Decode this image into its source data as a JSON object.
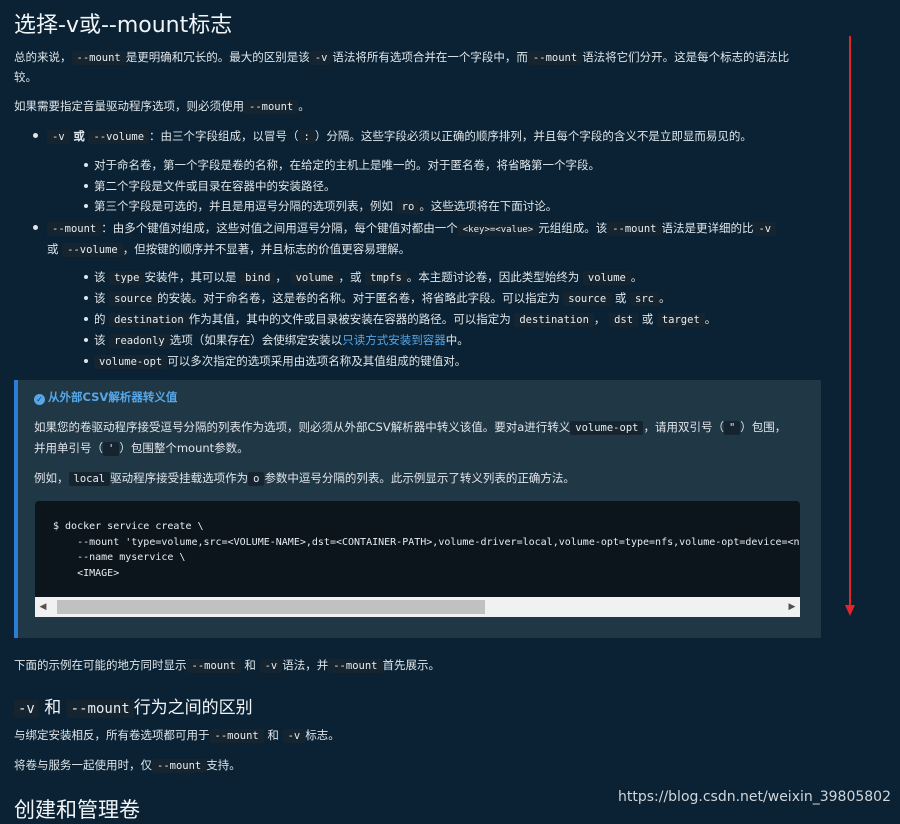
{
  "title": "选择-v或--mount标志",
  "intro": {
    "p1_a": "总的来说，",
    "p1_code1": "--mount",
    "p1_b": "是更明确和冗长的。最大的区别是该",
    "p1_code2": "-v",
    "p1_c": "语法将所有选项合并在一个字段中，而",
    "p1_code3": "--mount",
    "p1_d": "语法将它们分开。这是每个标志的语法比",
    "p1_e": "较。",
    "p2_a": "如果需要指定音量驱动程序选项，则必须使用",
    "p2_code": "--mount",
    "p2_b": "。"
  },
  "bullet_v": {
    "code1": "-v",
    "or": "或",
    "code2": "--volume",
    "text": "：由三个字段组成，以冒号（",
    "colon": ":",
    "text2": "）分隔。这些字段必须以正确的顺序排列，并且每个字段的含义不是立即显而易见的。",
    "sub1": "对于命名卷，第一个字段是卷的名称，在给定的主机上是唯一的。对于匿名卷，将省略第一个字段。",
    "sub2": "第二个字段是文件或目录在容器中的安装路径。",
    "sub3_a": "第三个字段是可选的，并且是用逗号分隔的选项列表，例如",
    "sub3_code": "ro",
    "sub3_b": "。这些选项将在下面讨论。"
  },
  "bullet_mount": {
    "code": "--mount",
    "text_a": "：由多个键值对组成，这些对值之间用逗号分隔，每个键值对都由一个",
    "kv": "<key>=<value>",
    "text_b": "元组组成。该",
    "code2": "--mount",
    "text_c": "语法是更详细的比",
    "code3": "-v",
    "line2_a": "或",
    "code4": "--volume",
    "line2_b": "，但按键的顺序并不显著，并且标志的价值更容易理解。",
    "s1_a": "该",
    "s1_c1": "type",
    "s1_b": "安装件，其可以是",
    "s1_c2": "bind",
    "s1_sep1": "，",
    "s1_c3": "volume",
    "s1_sep2": "，或",
    "s1_c4": "tmpfs",
    "s1_c": "。本主题讨论卷，因此类型始终为",
    "s1_c5": "volume",
    "s1_end": "。",
    "s2_a": "该",
    "s2_c1": "source",
    "s2_b": "的安装。对于命名卷，这是卷的名称。对于匿名卷，将省略此字段。可以指定为",
    "s2_c2": "source",
    "s2_or": "或",
    "s2_c3": "src",
    "s2_end": "。",
    "s3_a": "的",
    "s3_c1": "destination",
    "s3_b": "作为其值，其中的文件或目录被安装在容器的路径。可以指定为",
    "s3_c2": "destination",
    "s3_sep": "，",
    "s3_c3": "dst",
    "s3_or": "或",
    "s3_c4": "target",
    "s3_end": "。",
    "s4_a": "该",
    "s4_c1": "readonly",
    "s4_b": "选项（如果存在）会使绑定安装以",
    "s4_link": "只读方式安装到容器",
    "s4_c": "中。",
    "s5_c1": "volume-opt",
    "s5_b": "可以多次指定的选项采用由选项名称及其值组成的键值对。"
  },
  "note": {
    "title": "从外部CSV解析器转义值",
    "p1_a": "如果您的卷驱动程序接受逗号分隔的列表作为选项，则必须从外部CSV解析器中转义该值。要对a进行转义",
    "p1_code": "volume-opt",
    "p1_b": "，请用双引号（",
    "p1_q": "\"",
    "p1_c": "）包围，",
    "p2_a": "并用单引号（",
    "p2_q": "'",
    "p2_b": "）包围整个mount参数。",
    "p3_a": "例如，",
    "p3_code1": "local",
    "p3_b": "驱动程序接受挂载选项作为",
    "p3_code2": "o",
    "p3_c": "参数中逗号分隔的列表。此示例显示了转义列表的正确方法。",
    "code": "$ docker service create \\\n    --mount 'type=volume,src=<VOLUME-NAME>,dst=<CONTAINER-PATH>,volume-driver=local,volume-opt=type=nfs,volume-opt=device=<nfs-server>:<nfs-path>,\"volume-opt=o=addr=<nfs-address>,vers=4,soft,timeo=180,bg,tcp,rw\"'\n    --name myservice \\\n    <IMAGE>"
  },
  "after": {
    "p_a": "下面的示例在可能的地方同时显示",
    "p_c1": "--mount",
    "p_and": "和",
    "p_c2": "-v",
    "p_b": "语法，并",
    "p_c3": "--mount",
    "p_c": "首先展示。"
  },
  "section2": {
    "code1": "-v",
    "and": "和",
    "code2": "--mount",
    "title": "行为之间的区别",
    "p1_a": "与绑定安装相反，所有卷选项都可用于",
    "p1_c1": "--mount",
    "p1_and": "和",
    "p1_c2": "-v",
    "p1_b": "标志。",
    "p2_a": "将卷与服务一起使用时，仅",
    "p2_c": "--mount",
    "p2_b": "支持。"
  },
  "section3": {
    "title": "创建和管理卷"
  },
  "watermark": "https://blog.csdn.net/weixin_39805802",
  "colors": {
    "background": "#0a2233",
    "accent": "#56a7e8",
    "annotation": "#e0262a"
  }
}
